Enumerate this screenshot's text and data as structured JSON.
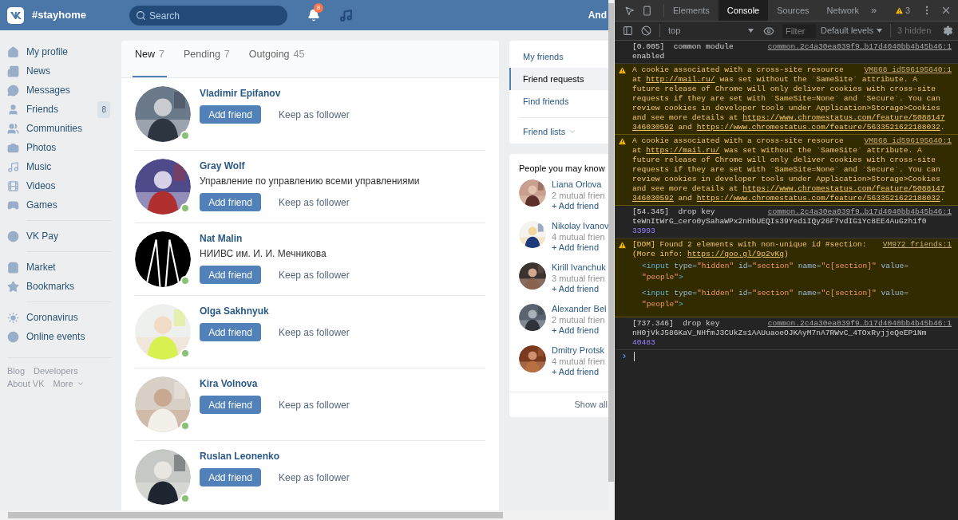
{
  "header": {
    "site_title": "#stayhome",
    "search": {
      "placeholder": "Search"
    },
    "notifications_badge": "8",
    "user_name": "And"
  },
  "sidebar": {
    "groups": [
      [
        {
          "label": "My profile"
        },
        {
          "label": "News"
        },
        {
          "label": "Messages"
        },
        {
          "label": "Friends",
          "badge": "8"
        },
        {
          "label": "Communities"
        },
        {
          "label": "Photos"
        },
        {
          "label": "Music"
        },
        {
          "label": "Videos"
        },
        {
          "label": "Games"
        }
      ],
      [
        {
          "label": "VK Pay"
        }
      ],
      [
        {
          "label": "Market"
        },
        {
          "label": "Bookmarks"
        }
      ],
      [
        {
          "label": "Coronavirus"
        },
        {
          "label": "Online events"
        }
      ]
    ],
    "footer_links": [
      [
        "Blog",
        "Developers"
      ],
      [
        "About VK",
        "More"
      ]
    ]
  },
  "requests": {
    "tabs": [
      {
        "label": "New",
        "count": "7",
        "selected": true
      },
      {
        "label": "Pending",
        "count": "7",
        "selected": false
      },
      {
        "label": "Outgoing",
        "count": "45",
        "selected": false
      }
    ],
    "items": [
      {
        "name": "Vladimir Epifanov",
        "online": true,
        "add": "Add friend",
        "keep": "Keep as follower"
      },
      {
        "name": "Gray Wolf",
        "subtitle": "Управление по управлению всеми управлениями",
        "online": true,
        "add": "Add friend",
        "keep": "Keep as follower"
      },
      {
        "name": "Nat Malin",
        "subtitle": "НИИВС им. И. И. Мечникова",
        "online": true,
        "add": "Add friend",
        "keep": "Keep as follower"
      },
      {
        "name": "Olga Sakhnyuk",
        "online": true,
        "add": "Add friend",
        "keep": "Keep as follower"
      },
      {
        "name": "Kira Volnova",
        "online": true,
        "add": "Add friend",
        "keep": "Keep as follower"
      },
      {
        "name": "Ruslan Leonenko",
        "online": true,
        "add": "Add friend",
        "keep": "Keep as follower"
      }
    ]
  },
  "friends_menu": {
    "items": [
      {
        "label": "My friends",
        "selected": false
      },
      {
        "label": "Friend requests",
        "selected": true
      },
      {
        "label": "Find friends",
        "selected": false
      }
    ],
    "lists": "Friend lists"
  },
  "people_you_may_know": {
    "title": "People you may know",
    "items": [
      {
        "name": "Liana Orlova",
        "mutual": "2 mutual frien",
        "add": "+ Add friend"
      },
      {
        "name": "Nikolay Ivanov",
        "mutual": "4 mutual frien",
        "add": "+ Add friend"
      },
      {
        "name": "Kirill Ivanchuk",
        "mutual": "3 mutual frien",
        "add": "+ Add friend"
      },
      {
        "name": "Alexander Bel",
        "mutual": "2 mutual frien",
        "add": "+ Add friend"
      },
      {
        "name": "Dmitry Protsk",
        "mutual": "4 mutual frien",
        "add": "+ Add friend"
      }
    ],
    "show_all": "Show all"
  },
  "devtools": {
    "tabs": [
      {
        "label": "Elements",
        "selected": false
      },
      {
        "label": "Console",
        "selected": true
      },
      {
        "label": "Sources",
        "selected": false
      },
      {
        "label": "Network",
        "selected": false
      }
    ],
    "more_tabs": "»",
    "warning_count": "3",
    "context": "top",
    "filter": {
      "placeholder": "Filter"
    },
    "levels": "Default levels",
    "hidden": "3 hidden",
    "messages": [
      {
        "kind": "log",
        "source": "common.2c4a30ea039f9…b17d4040bb4b45b46:1",
        "lines": [
          [
            {
              "kind": "text",
              "text": "[0.005]  common module"
            }
          ],
          [
            {
              "kind": "text",
              "text": "enabled"
            }
          ]
        ]
      },
      {
        "kind": "warning",
        "source": "VM868 id596195640:1",
        "lines": [
          [
            {
              "kind": "text",
              "text": "A cookie associated with a cross-site resource"
            }
          ],
          [
            {
              "kind": "text",
              "text": "at "
            },
            {
              "kind": "link",
              "text": "http://mail.ru/"
            },
            {
              "kind": "text",
              "text": " was set without the `SameSite` attribute. A"
            }
          ],
          [
            {
              "kind": "text",
              "text": "future release of Chrome will only deliver cookies with cross-site"
            }
          ],
          [
            {
              "kind": "text",
              "text": "requests if they are set with `SameSite=None` and `Secure`. You can"
            }
          ],
          [
            {
              "kind": "text",
              "text": "review cookies in developer tools under Application>Storage>Cookies"
            }
          ],
          [
            {
              "kind": "text",
              "text": "and see more details at "
            },
            {
              "kind": "link",
              "text": "https://www.chromestatus.com/feature/5088147"
            }
          ],
          [
            {
              "kind": "link",
              "text": "346030592"
            },
            {
              "kind": "text",
              "text": " and "
            },
            {
              "kind": "link",
              "text": "https://www.chromestatus.com/feature/5633521622188032"
            },
            {
              "kind": "text",
              "text": "."
            }
          ]
        ]
      },
      {
        "kind": "warning",
        "source": "VM868 id596195640:1",
        "lines": [
          [
            {
              "kind": "text",
              "text": "A cookie associated with a cross-site resource"
            }
          ],
          [
            {
              "kind": "text",
              "text": "at "
            },
            {
              "kind": "link",
              "text": "https://mail.ru/"
            },
            {
              "kind": "text",
              "text": " was set without the `SameSite` attribute. A"
            }
          ],
          [
            {
              "kind": "text",
              "text": "future release of Chrome will only deliver cookies with cross-site"
            }
          ],
          [
            {
              "kind": "text",
              "text": "requests if they are set with `SameSite=None` and `Secure`. You can"
            }
          ],
          [
            {
              "kind": "text",
              "text": "review cookies in developer tools under Application>Storage>Cookies"
            }
          ],
          [
            {
              "kind": "text",
              "text": "and see more details at "
            },
            {
              "kind": "link",
              "text": "https://www.chromestatus.com/feature/5088147"
            }
          ],
          [
            {
              "kind": "link",
              "text": "346030592"
            },
            {
              "kind": "text",
              "text": " and "
            },
            {
              "kind": "link",
              "text": "https://www.chromestatus.com/feature/5633521622188032"
            },
            {
              "kind": "text",
              "text": "."
            }
          ]
        ]
      },
      {
        "kind": "log",
        "source": "common.2c4a30ea039f9…b17d4040bb4b45b46:1",
        "lines": [
          [
            {
              "kind": "text",
              "text": "[54.345]  drop key"
            }
          ],
          [
            {
              "kind": "text",
              "text": "teWnItWrG_cero0ySahaWPx2nHbUEQIs39YediIQy26F7vdIG1Yc8EE4AuGzh1f0"
            }
          ]
        ],
        "number": "33993"
      },
      {
        "kind": "warning",
        "source": "VM972 friends:1",
        "lines": [
          [
            {
              "kind": "text",
              "text": "[DOM] Found 2 elements with non-unique id #section:"
            }
          ],
          [
            {
              "kind": "text",
              "text": "(More info: "
            },
            {
              "kind": "link",
              "text": "https://goo.gl/9p2vKg"
            },
            {
              "kind": "text",
              "text": ")"
            }
          ]
        ],
        "snippets": [
          [
            [
              {
                "kind": "tag",
                "text": "<input"
              },
              {
                "kind": "attr",
                "text": " type"
              },
              {
                "kind": "eq",
                "text": "="
              },
              {
                "kind": "val",
                "text": "\"hidden\""
              },
              {
                "kind": "attr",
                "text": " id"
              },
              {
                "kind": "eq",
                "text": "="
              },
              {
                "kind": "val",
                "text": "\"section\""
              },
              {
                "kind": "attr",
                "text": " name"
              },
              {
                "kind": "eq",
                "text": "="
              },
              {
                "kind": "val",
                "text": "\"c[section]\""
              },
              {
                "kind": "attr",
                "text": " value"
              },
              {
                "kind": "eq",
                "text": "="
              }
            ],
            [
              {
                "kind": "val",
                "text": "\"people\""
              },
              {
                "kind": "tag",
                "text": ">"
              }
            ]
          ],
          [
            [
              {
                "kind": "tag",
                "text": "<input"
              },
              {
                "kind": "attr",
                "text": " type"
              },
              {
                "kind": "eq",
                "text": "="
              },
              {
                "kind": "val",
                "text": "\"hidden\""
              },
              {
                "kind": "attr",
                "text": " id"
              },
              {
                "kind": "eq",
                "text": "="
              },
              {
                "kind": "val",
                "text": "\"section\""
              },
              {
                "kind": "attr",
                "text": " name"
              },
              {
                "kind": "eq",
                "text": "="
              },
              {
                "kind": "val",
                "text": "\"c[section]\""
              },
              {
                "kind": "attr",
                "text": " value"
              },
              {
                "kind": "eq",
                "text": "="
              }
            ],
            [
              {
                "kind": "val",
                "text": "\"people\""
              },
              {
                "kind": "tag",
                "text": ">"
              }
            ]
          ]
        ]
      },
      {
        "kind": "log",
        "source": "common.2c4a30ea039f9…b17d4040bb4b45b46:1",
        "lines": [
          [
            {
              "kind": "text",
              "text": "[737.346]  drop key"
            }
          ],
          [
            {
              "kind": "text",
              "text": "nH0jVkJ586KaV_NHfmJ3CUkZs1AAUuaoeOJKAyM7nA7RWvC_4TOxRyjjeQeEP1Nm"
            }
          ]
        ],
        "number": "40483"
      }
    ],
    "prompt": "›"
  }
}
